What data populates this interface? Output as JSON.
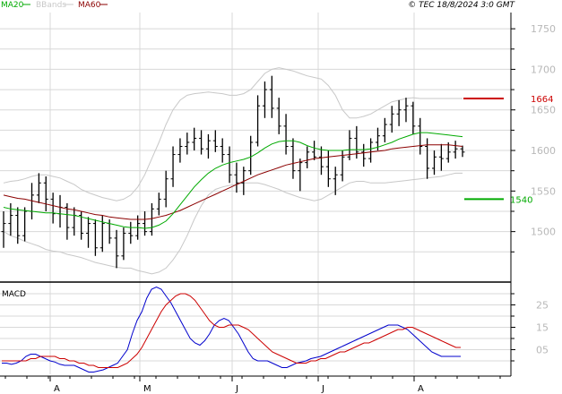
{
  "header": {
    "legend": [
      {
        "label": "MA20",
        "color": "#00aa00"
      },
      {
        "label": "BBands",
        "color": "#c8c8c8"
      },
      {
        "label": "MA60",
        "color": "#8b0000"
      }
    ],
    "copyright": "© TEC 18/8/2024 3:0 GMT"
  },
  "chart_data": [
    {
      "type": "ohlc",
      "panel": "price",
      "y_ticks": [
        1500,
        1550,
        1600,
        1650,
        1700,
        1750
      ],
      "y_tick_labels": [
        "1500",
        "1550",
        "1600",
        "1650",
        "1700",
        "1750"
      ],
      "ylim": [
        1440,
        1770
      ],
      "grid": true,
      "levels": [
        {
          "label": "1664",
          "value": 1664,
          "color": "#cc0000"
        },
        {
          "label": "1540",
          "value": 1540,
          "color": "#00aa00"
        }
      ],
      "bars": [
        [
          1500,
          1525,
          1480,
          1510
        ],
        [
          1510,
          1535,
          1495,
          1520
        ],
        [
          1520,
          1530,
          1485,
          1495
        ],
        [
          1495,
          1530,
          1488,
          1525
        ],
        [
          1525,
          1560,
          1515,
          1545
        ],
        [
          1545,
          1572,
          1535,
          1560
        ],
        [
          1560,
          1568,
          1525,
          1540
        ],
        [
          1540,
          1548,
          1510,
          1522
        ],
        [
          1522,
          1545,
          1505,
          1530
        ],
        [
          1530,
          1535,
          1490,
          1505
        ],
        [
          1505,
          1530,
          1495,
          1520
        ],
        [
          1520,
          1525,
          1490,
          1498
        ],
        [
          1498,
          1518,
          1480,
          1510
        ],
        [
          1510,
          1515,
          1470,
          1480
        ],
        [
          1480,
          1520,
          1475,
          1510
        ],
        [
          1510,
          1515,
          1485,
          1492
        ],
        [
          1492,
          1502,
          1455,
          1470
        ],
        [
          1470,
          1505,
          1465,
          1498
        ],
        [
          1498,
          1512,
          1485,
          1495
        ],
        [
          1495,
          1520,
          1490,
          1510
        ],
        [
          1510,
          1525,
          1495,
          1500
        ],
        [
          1500,
          1535,
          1495,
          1528
        ],
        [
          1528,
          1548,
          1520,
          1540
        ],
        [
          1540,
          1575,
          1530,
          1565
        ],
        [
          1565,
          1605,
          1555,
          1595
        ],
        [
          1595,
          1615,
          1585,
          1605
        ],
        [
          1605,
          1622,
          1595,
          1610
        ],
        [
          1610,
          1628,
          1600,
          1615
        ],
        [
          1615,
          1625,
          1595,
          1602
        ],
        [
          1602,
          1620,
          1590,
          1612
        ],
        [
          1612,
          1625,
          1598,
          1605
        ],
        [
          1605,
          1615,
          1585,
          1595
        ],
        [
          1595,
          1605,
          1560,
          1570
        ],
        [
          1570,
          1585,
          1548,
          1560
        ],
        [
          1560,
          1580,
          1545,
          1575
        ],
        [
          1575,
          1618,
          1570,
          1610
        ],
        [
          1610,
          1668,
          1605,
          1655
        ],
        [
          1655,
          1685,
          1640,
          1675
        ],
        [
          1675,
          1692,
          1640,
          1652
        ],
        [
          1652,
          1665,
          1620,
          1630
        ],
        [
          1630,
          1645,
          1595,
          1605
        ],
        [
          1605,
          1615,
          1565,
          1575
        ],
        [
          1575,
          1590,
          1550,
          1585
        ],
        [
          1585,
          1605,
          1578,
          1598
        ],
        [
          1598,
          1612,
          1588,
          1592
        ],
        [
          1592,
          1605,
          1570,
          1580
        ],
        [
          1580,
          1600,
          1555,
          1565
        ],
        [
          1565,
          1580,
          1545,
          1570
        ],
        [
          1570,
          1600,
          1562,
          1592
        ],
        [
          1592,
          1625,
          1588,
          1615
        ],
        [
          1615,
          1630,
          1590,
          1598
        ],
        [
          1598,
          1608,
          1580,
          1590
        ],
        [
          1590,
          1615,
          1585,
          1610
        ],
        [
          1610,
          1628,
          1600,
          1618
        ],
        [
          1618,
          1640,
          1610,
          1632
        ],
        [
          1632,
          1655,
          1622,
          1645
        ],
        [
          1645,
          1662,
          1630,
          1650
        ],
        [
          1650,
          1665,
          1635,
          1655
        ],
        [
          1655,
          1660,
          1620,
          1630
        ],
        [
          1630,
          1640,
          1595,
          1605
        ],
        [
          1605,
          1615,
          1565,
          1578
        ],
        [
          1578,
          1600,
          1570,
          1592
        ],
        [
          1592,
          1608,
          1575,
          1590
        ],
        [
          1590,
          1610,
          1585,
          1598
        ],
        [
          1598,
          1612,
          1590,
          1602
        ],
        [
          1602,
          1606,
          1592,
          1598
        ]
      ],
      "ma20": [
        1530,
        1528,
        1527,
        1526,
        1525,
        1524,
        1523,
        1523,
        1522,
        1521,
        1520,
        1518,
        1516,
        1514,
        1512,
        1510,
        1508,
        1506,
        1505,
        1505,
        1504,
        1505,
        1508,
        1513,
        1522,
        1533,
        1544,
        1555,
        1564,
        1572,
        1578,
        1582,
        1585,
        1587,
        1589,
        1592,
        1597,
        1603,
        1608,
        1611,
        1612,
        1612,
        1610,
        1606,
        1603,
        1601,
        1600,
        1600,
        1600,
        1601,
        1601,
        1601,
        1602,
        1604,
        1607,
        1610,
        1614,
        1617,
        1620,
        1622,
        1622,
        1621,
        1620,
        1619,
        1618,
        1617
      ],
      "ma60": [
        1545,
        1543,
        1541,
        1540,
        1538,
        1536,
        1534,
        1532,
        1530,
        1528,
        1527,
        1525,
        1523,
        1521,
        1520,
        1518,
        1517,
        1516,
        1515,
        1515,
        1515,
        1516,
        1518,
        1520,
        1523,
        1526,
        1530,
        1534,
        1538,
        1542,
        1546,
        1550,
        1554,
        1558,
        1562,
        1566,
        1570,
        1573,
        1576,
        1579,
        1582,
        1584,
        1586,
        1588,
        1590,
        1591,
        1592,
        1593,
        1594,
        1595,
        1596,
        1597,
        1598,
        1599,
        1600,
        1602,
        1603,
        1604,
        1605,
        1606,
        1607,
        1607,
        1607,
        1607,
        1606,
        1605
      ],
      "bb_upper": [
        1560,
        1562,
        1563,
        1565,
        1568,
        1570,
        1570,
        1568,
        1566,
        1562,
        1558,
        1552,
        1548,
        1545,
        1542,
        1540,
        1538,
        1540,
        1545,
        1555,
        1570,
        1590,
        1610,
        1632,
        1650,
        1662,
        1668,
        1670,
        1671,
        1672,
        1671,
        1670,
        1668,
        1668,
        1670,
        1675,
        1685,
        1695,
        1700,
        1702,
        1700,
        1698,
        1695,
        1692,
        1690,
        1688,
        1680,
        1668,
        1650,
        1640,
        1640,
        1642,
        1645,
        1650,
        1655,
        1660,
        1662,
        1664,
        1665,
        1664,
        1664,
        1664,
        1664,
        1664,
        1664,
        1664
      ],
      "bb_lower": [
        1500,
        1495,
        1492,
        1488,
        1485,
        1482,
        1478,
        1476,
        1475,
        1472,
        1470,
        1468,
        1465,
        1462,
        1460,
        1458,
        1456,
        1455,
        1455,
        1452,
        1450,
        1448,
        1450,
        1455,
        1465,
        1478,
        1495,
        1515,
        1532,
        1545,
        1552,
        1555,
        1557,
        1558,
        1560,
        1560,
        1560,
        1558,
        1555,
        1552,
        1548,
        1545,
        1542,
        1540,
        1538,
        1540,
        1545,
        1550,
        1555,
        1560,
        1562,
        1562,
        1560,
        1560,
        1560,
        1561,
        1562,
        1563,
        1564,
        1565,
        1566,
        1567,
        1568,
        1570,
        1572,
        1572
      ]
    },
    {
      "type": "line",
      "panel": "macd",
      "title": "MACD",
      "y_ticks": [
        5,
        15,
        25
      ],
      "y_tick_labels": [
        "05",
        "15",
        "25"
      ],
      "ylim": [
        -6,
        34
      ],
      "series": [
        {
          "color": "#0000cc",
          "values": [
            -1,
            -1,
            -1.5,
            -1,
            0,
            2,
            3,
            3,
            2,
            1,
            0,
            -0.5,
            -1.5,
            -2,
            -2,
            -2,
            -3,
            -4,
            -5,
            -5,
            -4.5,
            -4,
            -3,
            -2,
            -1,
            2,
            5,
            12,
            18,
            22,
            28,
            32,
            33,
            32,
            29,
            26,
            22,
            18,
            14,
            10,
            8,
            7,
            9,
            12,
            16,
            18,
            19,
            18,
            15,
            12,
            8,
            4,
            1,
            0,
            0,
            0,
            -1,
            -2,
            -3,
            -3,
            -2,
            -1,
            -0.5,
            0,
            1,
            1.5,
            2,
            3,
            4,
            5,
            6,
            7,
            8,
            9,
            10,
            11,
            12,
            13,
            14,
            15,
            16,
            16,
            16,
            15,
            14,
            12,
            10,
            8,
            6,
            4,
            3,
            2,
            2,
            2,
            2,
            2
          ]
        },
        {
          "color": "#cc0000",
          "values": [
            0,
            0,
            0,
            0,
            0,
            0,
            1,
            1,
            2,
            2,
            2,
            2,
            1,
            1,
            0,
            0,
            -1,
            -1,
            -2,
            -2,
            -3,
            -3,
            -3,
            -3,
            -3,
            -2,
            -1,
            1,
            3,
            6,
            10,
            14,
            18,
            22,
            25,
            27,
            29,
            30,
            30,
            29,
            27,
            24,
            21,
            18,
            16,
            15,
            15,
            16,
            16,
            16,
            15,
            14,
            12,
            10,
            8,
            6,
            4,
            3,
            2,
            1,
            0,
            -1,
            -1,
            -1,
            0,
            0,
            1,
            1,
            2,
            3,
            4,
            4,
            5,
            6,
            7,
            8,
            8,
            9,
            10,
            11,
            12,
            13,
            14,
            14,
            15,
            15,
            14,
            13,
            12,
            11,
            10,
            9,
            8,
            7,
            6,
            6
          ]
        }
      ]
    }
  ],
  "x_axis": {
    "month_labels": [
      "A",
      "M",
      "J",
      "J",
      "A"
    ]
  }
}
